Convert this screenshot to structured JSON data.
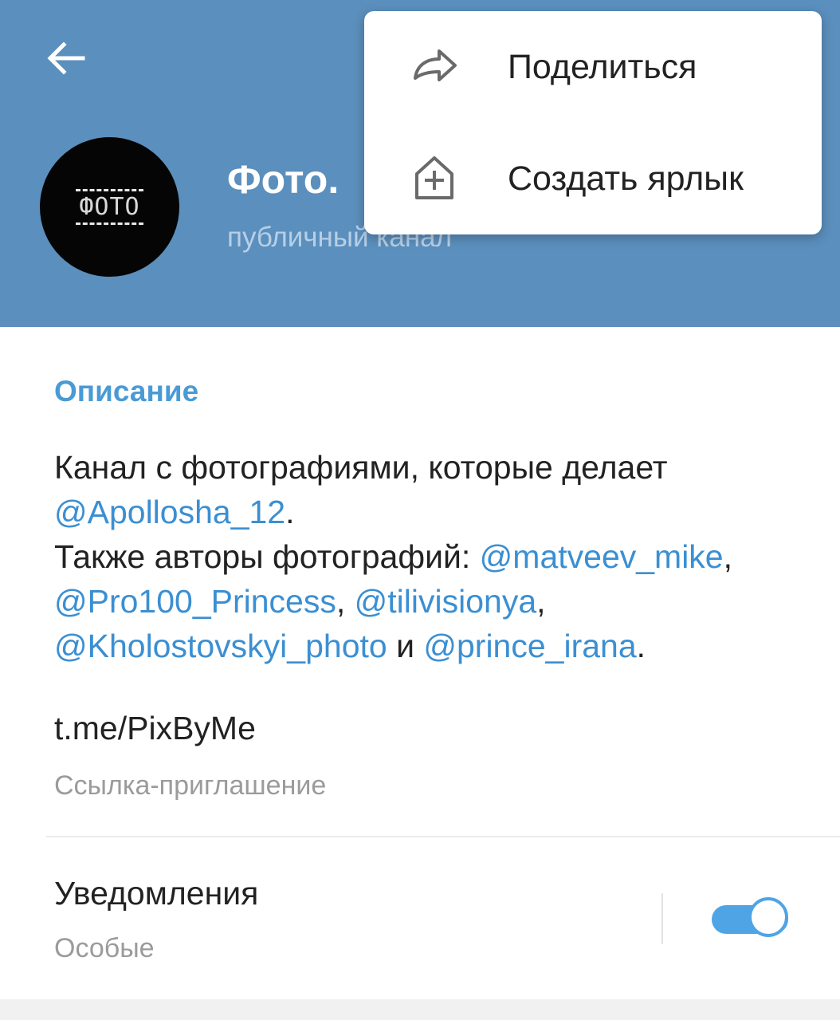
{
  "header": {
    "title": "Фото.",
    "subtitle": "публичный канал",
    "avatar_text": "ФОТО",
    "back_icon": "arrow-left-icon",
    "background_color": "#5b8fbd"
  },
  "menu": {
    "items": [
      {
        "label": "Поделиться",
        "icon": "share-arrow-icon"
      },
      {
        "label": "Создать ярлык",
        "icon": "add-shortcut-icon"
      }
    ]
  },
  "info": {
    "section_title": "Описание",
    "description": {
      "part1": "Канал с фотографиями, которые делает ",
      "mention1": "@Apollosha_12",
      "part2": ".",
      "part3": "Также авторы фотографий: ",
      "mention2": "@matveev_mike",
      "sep1": ", ",
      "mention3": "@Pro100_Princess",
      "sep2": ", ",
      "mention4": "@tilivisionya",
      "sep3": ", ",
      "mention5": "@Kholostovskyi_photo",
      "sep4": " и ",
      "mention6": "@prince_irana",
      "end": "."
    },
    "invite_link": "t.me/PixByMe",
    "invite_caption": "Ссылка-приглашение"
  },
  "notifications": {
    "title": "Уведомления",
    "subtitle": "Особые",
    "enabled": true
  },
  "colors": {
    "accent": "#4fa4e6",
    "link": "#3b8fd2",
    "section_title": "#4a9ad6"
  }
}
